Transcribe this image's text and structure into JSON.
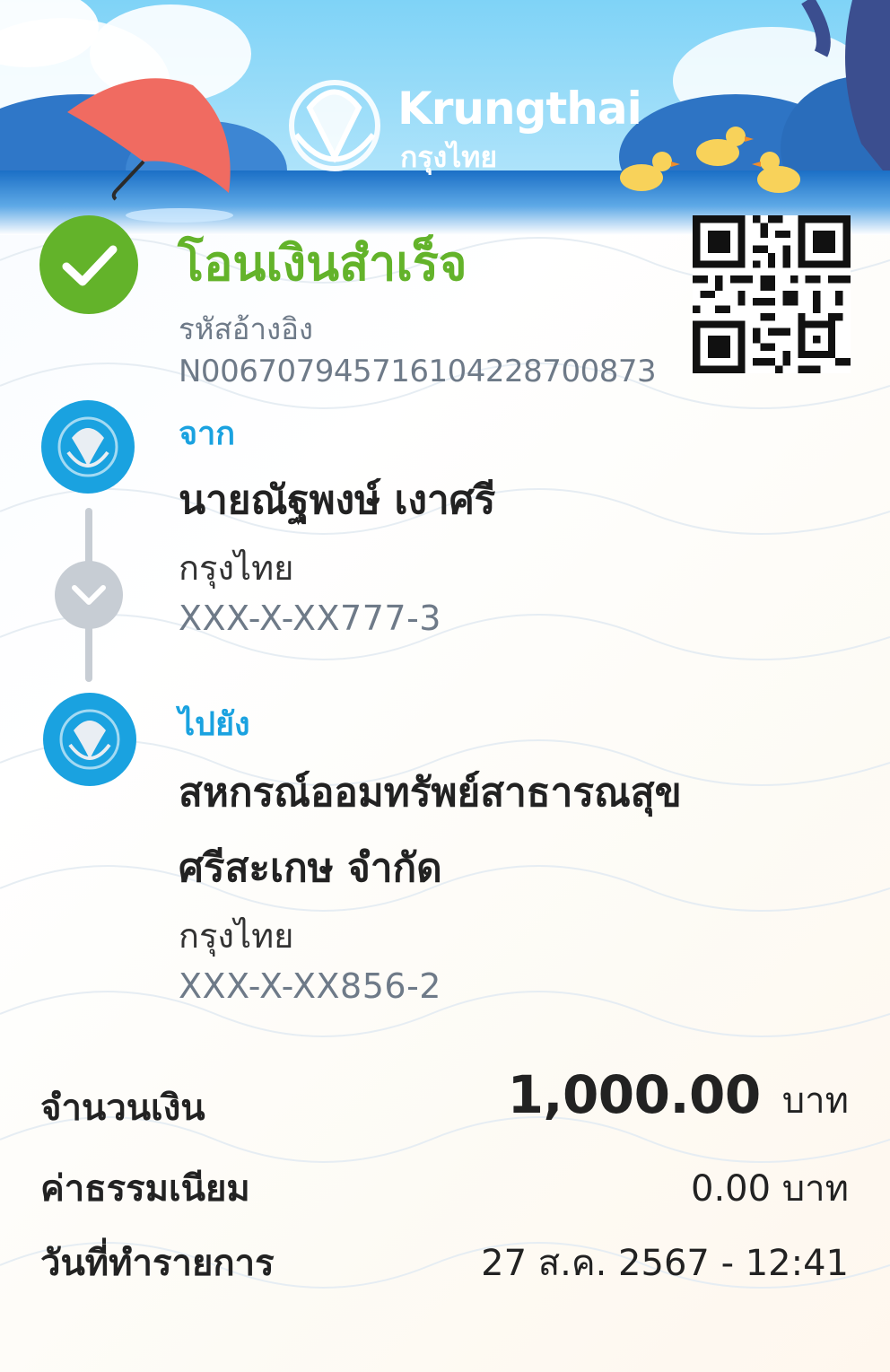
{
  "header": {
    "brand_en": "Krungthai",
    "brand_th": "กรุงไทย"
  },
  "status": {
    "title": "โอนเงินสำเร็จ",
    "ref_label": "รหัสอ้างอิง",
    "ref_value": "N006707945716104228700873",
    "icon": "check-icon",
    "color": "#63b32a"
  },
  "from": {
    "label": "จาก",
    "name": "นายณัฐพงษ์ เงาศรี",
    "bank": "กรุงไทย",
    "account": "XXX-X-XX777-3"
  },
  "to": {
    "label": "ไปยัง",
    "name_line1": "สหกรณ์ออมทรัพย์สาธารณสุข",
    "name_line2": "ศรีสะเกษ จำกัด",
    "bank": "กรุงไทย",
    "account": "XXX-X-XX856-2"
  },
  "summary": {
    "amount_label": "จำนวนเงิน",
    "amount_value": "1,000.00",
    "amount_unit": "บาท",
    "fee_label": "ค่าธรรมเนียม",
    "fee_value": "0.00 บาท",
    "date_label": "วันที่ทำรายการ",
    "date_value": "27 ส.ค. 2567 - 12:41"
  },
  "colors": {
    "accent_blue": "#1aa2e0",
    "success_green": "#63b32a",
    "muted": "#6e7a88"
  }
}
